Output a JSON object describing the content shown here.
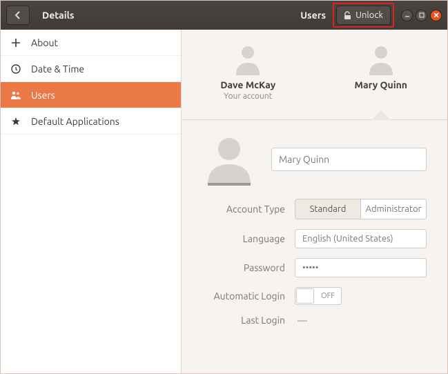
{
  "header": {
    "title": "Details",
    "context": "Users",
    "unlock": "Unlock"
  },
  "sidebar": {
    "items": [
      {
        "label": "About"
      },
      {
        "label": "Date & Time"
      },
      {
        "label": "Users"
      },
      {
        "label": "Default Applications"
      }
    ]
  },
  "users": [
    {
      "name": "Dave McKay",
      "sub": "Your account"
    },
    {
      "name": "Mary Quinn",
      "sub": ""
    }
  ],
  "detail": {
    "full_name": "Mary Quinn",
    "account_type_label": "Account Type",
    "account_type_options": [
      "Standard",
      "Administrator"
    ],
    "language_label": "Language",
    "language_value": "English (United States)",
    "password_label": "Password",
    "password_value": "•••••",
    "auto_login_label": "Automatic Login",
    "auto_login_state": "OFF",
    "last_login_label": "Last Login",
    "last_login_value": "—"
  }
}
